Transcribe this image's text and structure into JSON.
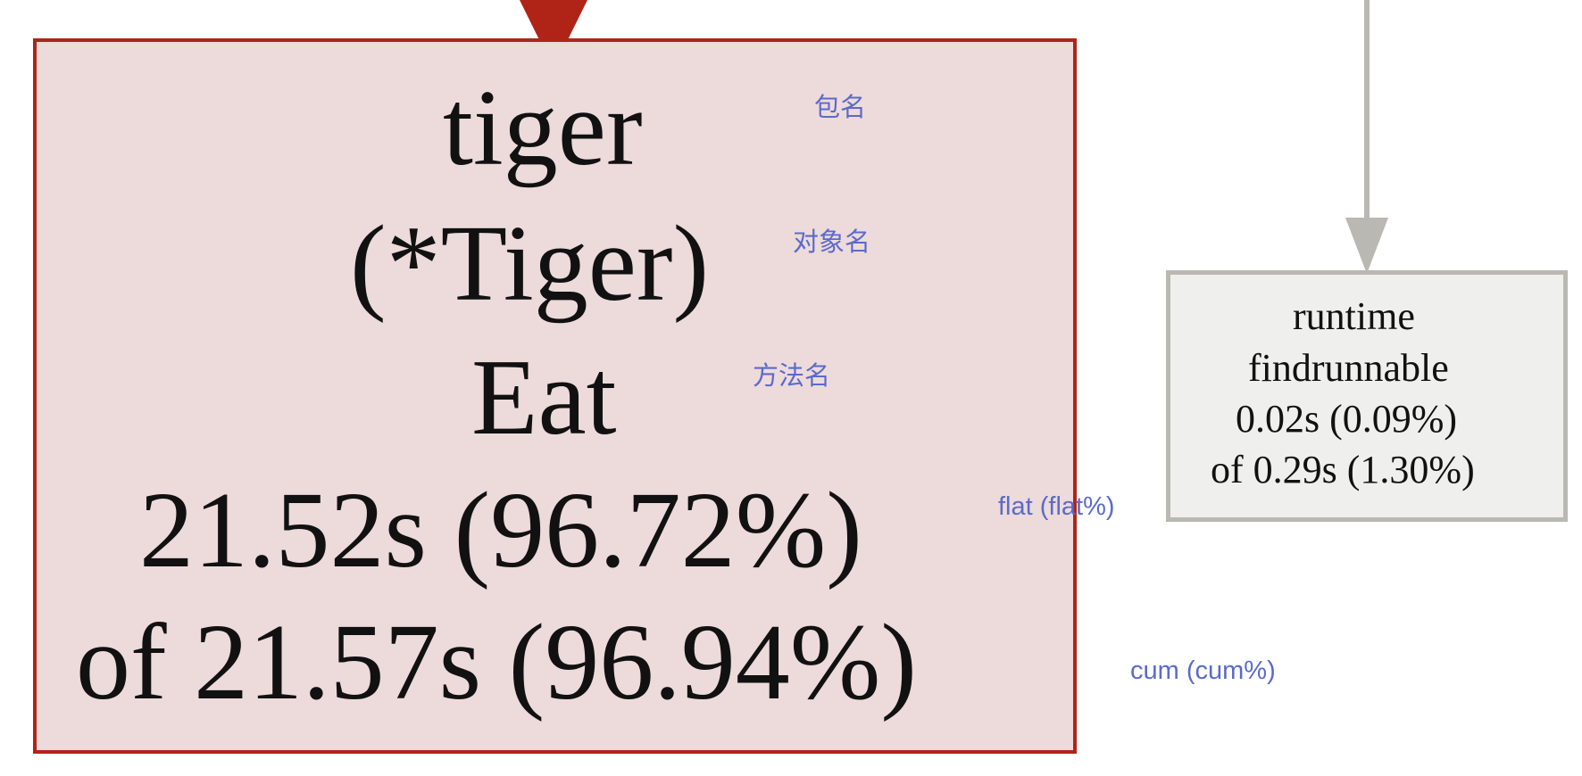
{
  "nodes": {
    "main": {
      "package": "tiger",
      "object": "(*Tiger)",
      "method": "Eat",
      "flat": "21.52s (96.72%)",
      "cum": "of 21.57s (96.94%)"
    },
    "runtime": {
      "package": "runtime",
      "function": "findrunnable",
      "flat": "0.02s (0.09%)",
      "cum": "of 0.29s (1.30%)"
    }
  },
  "annotations": {
    "package": "包名",
    "object": "对象名",
    "method": "方法名",
    "flat": "flat (flat%)",
    "cum": "cum (cum%)"
  },
  "colors": {
    "main_fill": "#eddadb",
    "main_border": "#b02418",
    "runtime_fill": "#efefed",
    "runtime_border": "#bab8b3",
    "annotation_text": "#5a6bc9"
  }
}
